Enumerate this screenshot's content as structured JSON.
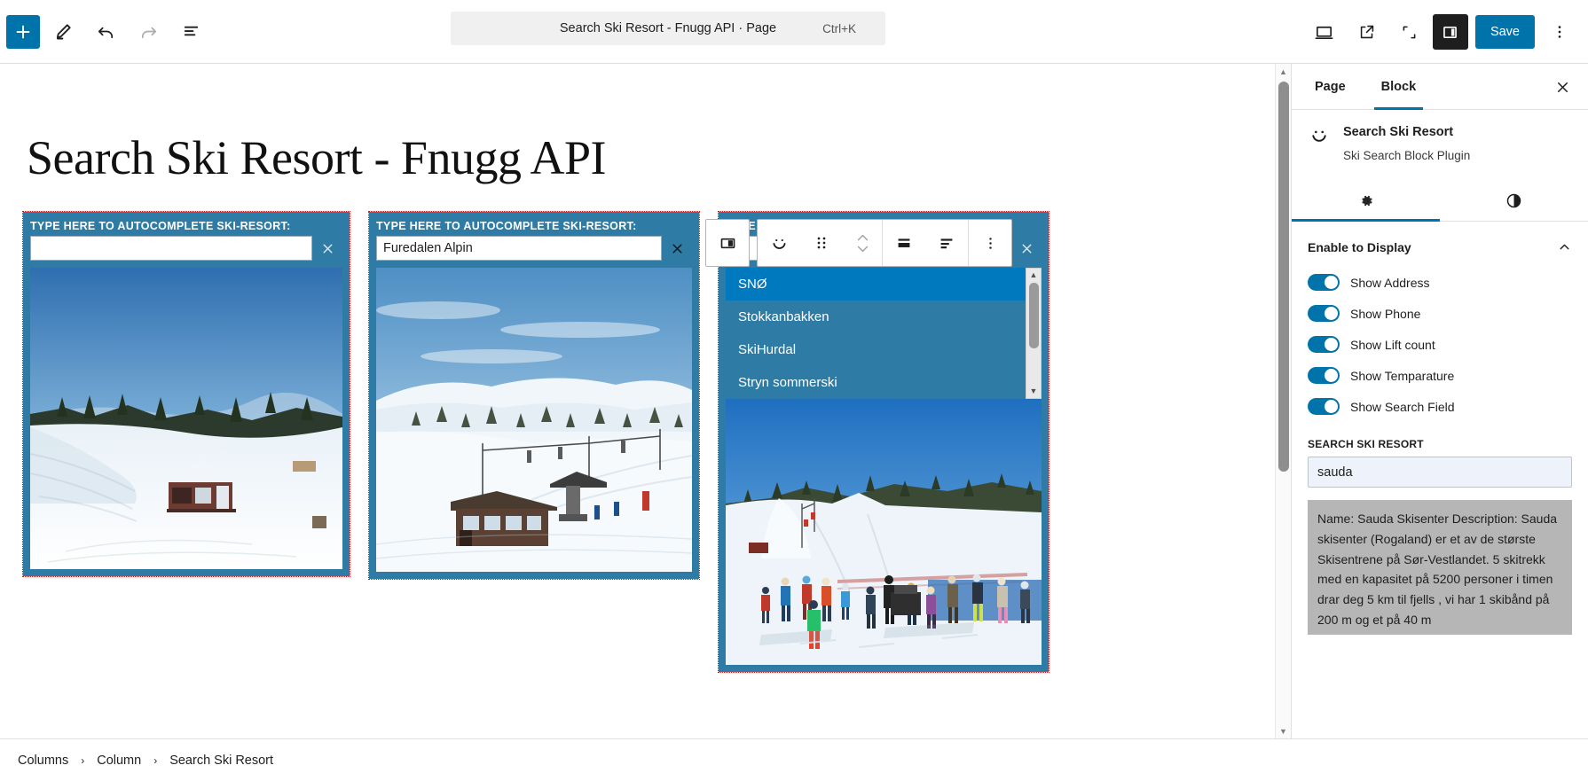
{
  "topbar": {
    "add_block_label": "+",
    "tools_icon": "pencil-icon",
    "undo_icon": "undo-icon",
    "redo_icon": "redo-icon",
    "list_view_icon": "list-view-icon",
    "command_bar": {
      "title": "Search Ski Resort - Fnugg API · Page",
      "shortcut": "Ctrl+K"
    },
    "view_icon": "desktop-preview-icon",
    "external_icon": "view-external-icon",
    "fullscreen_icon": "fullscreen-icon",
    "sidebar_toggle_icon": "settings-sidebar-icon",
    "save_label": "Save",
    "options_icon": "kebab-menu-icon"
  },
  "block_toolbar": {
    "parent_block_icon": "columns-icon",
    "block_type_icon": "smiley-icon",
    "drag_icon": "drag-handle-icon",
    "movers_icon": "move-up-down-icon",
    "vertical_align_icon": "vertical-align-icon",
    "text_align_icon": "text-align-icon",
    "more_icon": "kebab-menu-icon"
  },
  "canvas": {
    "post_title": "Search Ski Resort - Fnugg API",
    "columns": [
      {
        "label": "TYPE HERE TO AUTOCOMPLETE SKI-RESORT:",
        "input_value": "",
        "input_placeholder": "",
        "clear_icon": "close-icon",
        "image_alt": "snowy-slope-with-red-cabin",
        "has_dropdown": false
      },
      {
        "label": "TYPE HERE TO AUTOCOMPLETE SKI-RESORT:",
        "input_value": "Furedalen Alpin",
        "input_placeholder": "",
        "clear_icon": "close-icon",
        "image_alt": "ski-lift-station-on-snowy-mountain",
        "has_dropdown": false
      },
      {
        "label": "TYPE HERE TO AUTOCOMPLETE SKI-RESORT:",
        "input_value": "",
        "input_placeholder": "",
        "clear_icon": "close-icon",
        "image_alt": "ski-slope-with-skiers-and-children",
        "has_dropdown": true,
        "dropdown_options": [
          "SNØ",
          "Stokkanbakken",
          "SkiHurdal",
          "Stryn sommerski"
        ],
        "dropdown_selected": "SNØ"
      }
    ]
  },
  "sidebar": {
    "tabs": [
      {
        "label": "Page",
        "active": false
      },
      {
        "label": "Block",
        "active": true
      }
    ],
    "close_icon": "close-icon",
    "block": {
      "icon": "smiley-icon",
      "name": "Search Ski Resort",
      "description": "Ski Search Block Plugin"
    },
    "subtabs": [
      {
        "icon": "gear-icon",
        "active": true
      },
      {
        "icon": "contrast-icon",
        "active": false
      }
    ],
    "panel": {
      "title": "Enable to Display",
      "collapse_icon": "chevron-up-icon",
      "toggles": [
        {
          "label": "Show Address",
          "on": true
        },
        {
          "label": "Show Phone",
          "on": true
        },
        {
          "label": "Show Lift count",
          "on": true
        },
        {
          "label": "Show Temparature",
          "on": true
        },
        {
          "label": "Show Search Field",
          "on": true
        }
      ]
    },
    "search_field": {
      "label": "SEARCH SKI RESORT",
      "value": "sauda",
      "placeholder": ""
    },
    "result": "Name: Sauda Skisenter\nDescription: Sauda skisenter (Rogaland) er et av de største Skisentrene på Sør-Vestlandet. 5 skitrekk med en kapasitet på 5200 personer i timen drar deg 5 km til fjells , vi har 1 skibånd på 200 m og et på 40 m"
  },
  "breadcrumb": {
    "items": [
      "Columns",
      "Column",
      "Search Ski Resort"
    ],
    "separator": "›"
  },
  "colors": {
    "accent": "#0073aa",
    "widget_teal": "#2e7ba6",
    "dropdown_active": "#0079bf",
    "selection_red": "#cc1818",
    "result_bg": "#b6b6b6"
  }
}
